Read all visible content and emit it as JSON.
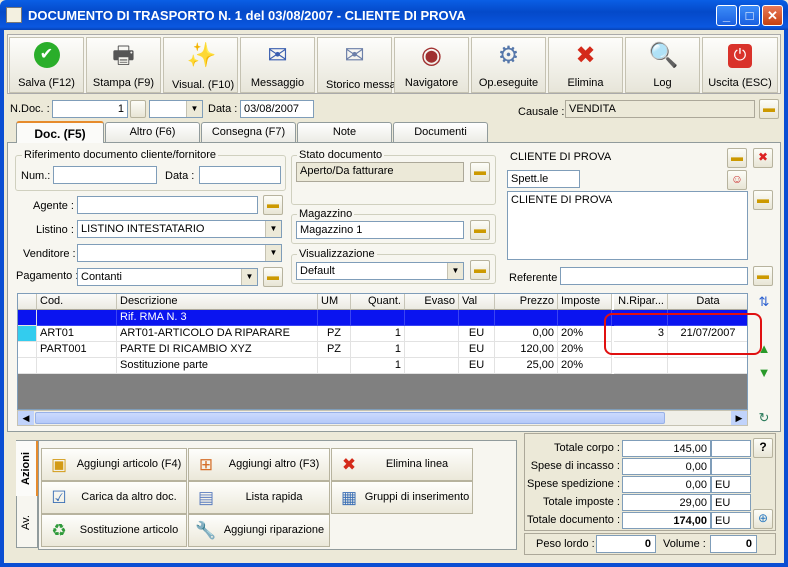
{
  "window": {
    "title": "DOCUMENTO DI TRASPORTO N. 1   del 03/08/2007 - CLIENTE DI PROVA",
    "minimize": "_",
    "maximize": "□",
    "close": "✕"
  },
  "toolbar": [
    {
      "label": "Salva (F12)",
      "icon": "save-check-icon",
      "glyph": "✔",
      "color": "#1f9a1f"
    },
    {
      "label": "Stampa (F9)",
      "icon": "printer-icon",
      "glyph": "🖶",
      "color": "#555555"
    },
    {
      "label": "Visual. (F10)",
      "icon": "magic-wand-icon",
      "glyph": "✨",
      "color": "#d9a400"
    },
    {
      "label": "Messaggio",
      "icon": "message-pen-icon",
      "glyph": "✉",
      "color": "#3b5fb0"
    },
    {
      "label": "Storico messaggi",
      "icon": "message-history-icon",
      "glyph": "✉",
      "color": "#6c7fa8"
    },
    {
      "label": "Navigatore",
      "icon": "compass-icon",
      "glyph": "◉",
      "color": "#a03030"
    },
    {
      "label": "Op.eseguite",
      "icon": "gears-icon",
      "glyph": "⚙",
      "color": "#5577aa"
    },
    {
      "label": "Elimina",
      "icon": "delete-x-icon",
      "glyph": "✖",
      "color": "#d42a1a"
    },
    {
      "label": "Log",
      "icon": "log-magnifier-icon",
      "glyph": "🔍",
      "color": "#2a6fc0"
    },
    {
      "label": "Uscita (ESC)",
      "icon": "exit-power-icon",
      "glyph": "⏻",
      "color": "#ffffff"
    }
  ],
  "header": {
    "ndoc_label": "N.Doc. :",
    "ndoc_value": "1",
    "data_label": "Data :",
    "data_value": "03/08/2007",
    "causale_label": "Causale :",
    "causale_value": "VENDITA"
  },
  "tabs": [
    "Doc. (F5)",
    "Altro (F6)",
    "Consegna (F7)",
    "Note",
    "Documenti"
  ],
  "form": {
    "rif_group": "Riferimento documento cliente/fornitore",
    "num_label": "Num.:",
    "num_value": "",
    "data_label": "Data :",
    "data_value": "",
    "agente_label": "Agente :",
    "agente_value": "",
    "listino_label": "Listino :",
    "listino_value": "LISTINO INTESTATARIO",
    "venditore_label": "Venditore :",
    "venditore_value": "",
    "pagamento_label": "Pagamento :",
    "pagamento_value": "Contanti",
    "stato_group": "Stato documento",
    "stato_value": "Aperto/Da fatturare",
    "magazzino_group": "Magazzino",
    "magazzino_value": "Magazzino 1",
    "visual_group": "Visualizzazione",
    "visual_value": "Default",
    "cliente_name": "CLIENTE DI PROVA",
    "cliente_salutation": "Spett.le",
    "cliente_address": "CLIENTE DI PROVA",
    "referente_label": "Referente :",
    "referente_value": ""
  },
  "grid": {
    "columns": [
      "Cod.",
      "Descrizione",
      "UM",
      "Quant.",
      "Evaso",
      "Val",
      "Prezzo",
      "Imposte",
      "N.Ripar...",
      "Data"
    ],
    "rows": [
      {
        "cod": "",
        "descr": "Rif. RMA N. 3",
        "um": "",
        "quant": "",
        "evaso": "",
        "val": "",
        "prezzo": "",
        "imposte": "",
        "nripar": "",
        "data": "",
        "selected": true
      },
      {
        "cod": "ART01",
        "descr": "ART01-ARTICOLO DA RIPARARE",
        "um": "PZ",
        "quant": "1",
        "evaso": "",
        "val": "EU",
        "prezzo": "0,00",
        "imposte": "20%",
        "nripar": "3",
        "data": "21/07/2007",
        "selected": false
      },
      {
        "cod": "PART001",
        "descr": "PARTE DI RICAMBIO XYZ",
        "um": "PZ",
        "quant": "1",
        "evaso": "",
        "val": "EU",
        "prezzo": "120,00",
        "imposte": "20%",
        "nripar": "",
        "data": "",
        "selected": false
      },
      {
        "cod": "",
        "descr": "Sostituzione parte",
        "um": "",
        "quant": "1",
        "evaso": "",
        "val": "EU",
        "prezzo": "25,00",
        "imposte": "20%",
        "nripar": "",
        "data": "",
        "selected": false
      }
    ]
  },
  "side_tabs": [
    "Azioni",
    "Av."
  ],
  "actions": [
    {
      "label": "Aggiungi articolo (F4)",
      "icon": "add-article-icon",
      "glyph": "▣",
      "color": "#d39b16"
    },
    {
      "label": "Aggiungi altro (F3)",
      "icon": "add-other-icon",
      "glyph": "⊞",
      "color": "#d56f2a"
    },
    {
      "label": "Elimina linea",
      "icon": "delete-line-icon",
      "glyph": "✖",
      "color": "#d42a1a"
    },
    {
      "label": "Carica da altro doc.",
      "icon": "load-doc-icon",
      "glyph": "☑",
      "color": "#3b6fb5"
    },
    {
      "label": "Lista rapida",
      "icon": "quick-list-icon",
      "glyph": "▤",
      "color": "#5b7dbf"
    },
    {
      "label": "Gruppi di inserimento",
      "icon": "insert-groups-icon",
      "glyph": "▦",
      "color": "#3b6fb5"
    },
    {
      "label": "Sostituzione articolo",
      "icon": "replace-article-icon",
      "glyph": "♻",
      "color": "#2f9a3a"
    },
    {
      "label": "Aggiungi riparazione",
      "icon": "add-repair-icon",
      "glyph": "🔧",
      "color": "#777777"
    }
  ],
  "totals": [
    {
      "label": "Totale corpo :",
      "value": "145,00",
      "unit": ""
    },
    {
      "label": "Spese di incasso :",
      "value": "0,00",
      "unit": ""
    },
    {
      "label": "Spese spedizione :",
      "value": "0,00",
      "unit": "EU"
    },
    {
      "label": "Totale imposte :",
      "value": "29,00",
      "unit": "EU"
    },
    {
      "label": "Totale documento :",
      "value": "174,00",
      "unit": "EU"
    }
  ],
  "footer": {
    "peso_label": "Peso lordo :",
    "peso_value": "0",
    "volume_label": "Volume :",
    "volume_value": "0",
    "help": "?"
  },
  "colors": {
    "titlebar": "#0a57e0",
    "selected_row": "#0a14f0",
    "highlight": "#e01010",
    "exit_button": "#d9322a"
  }
}
